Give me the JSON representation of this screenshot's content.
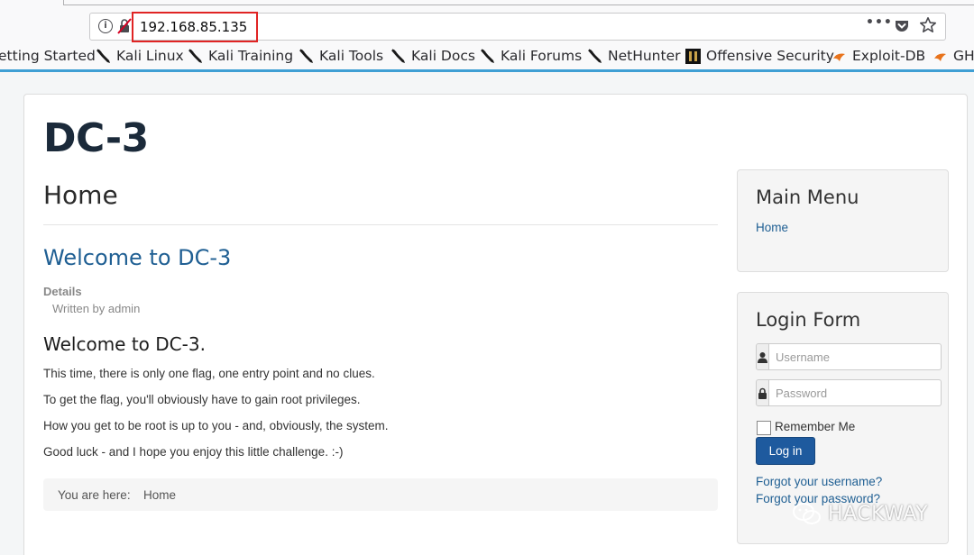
{
  "browser": {
    "url": "192.168.85.135",
    "menu_dots": "•••",
    "bookmarks": [
      {
        "label": "etting Started",
        "icon": "none"
      },
      {
        "label": "Kali Linux",
        "icon": "kali-dragon-icon"
      },
      {
        "label": "Kali Training",
        "icon": "kali-dragon-icon"
      },
      {
        "label": "Kali Tools",
        "icon": "kali-dragon-icon"
      },
      {
        "label": "Kali Docs",
        "icon": "kali-dragon-icon"
      },
      {
        "label": "Kali Forums",
        "icon": "kali-dragon-icon"
      },
      {
        "label": "NetHunter",
        "icon": "kali-dragon-icon"
      },
      {
        "label": "Offensive Security",
        "icon": "offsec-icon"
      },
      {
        "label": "Exploit-DB",
        "icon": "exploitdb-icon"
      },
      {
        "label": "GH",
        "icon": "exploitdb-icon"
      }
    ],
    "accent_color": "#3f9fd4"
  },
  "site": {
    "title": "DC-3"
  },
  "main": {
    "page_heading": "Home",
    "article": {
      "title": "Welcome to DC-3",
      "details_label": "Details",
      "written_by": "Written by admin",
      "subtitle": "Welcome to DC-3.",
      "paragraphs": [
        "This time, there is only one flag, one entry point and no clues.",
        "To get the flag, you'll obviously have to gain root privileges.",
        "How you get to be root is up to you - and, obviously, the system.",
        "Good luck - and I hope you enjoy this little challenge.  :-)"
      ]
    },
    "breadcrumb": {
      "label": "You are here:",
      "current": "Home"
    }
  },
  "sidebar": {
    "main_menu": {
      "title": "Main Menu",
      "items": [
        "Home"
      ]
    },
    "login_form": {
      "title": "Login Form",
      "username_placeholder": "Username",
      "password_placeholder": "Password",
      "remember_label": "Remember Me",
      "login_button": "Log in",
      "forgot_username": "Forgot your username?",
      "forgot_password": "Forgot your password?"
    }
  },
  "watermark": {
    "text": "HACKWAY"
  }
}
